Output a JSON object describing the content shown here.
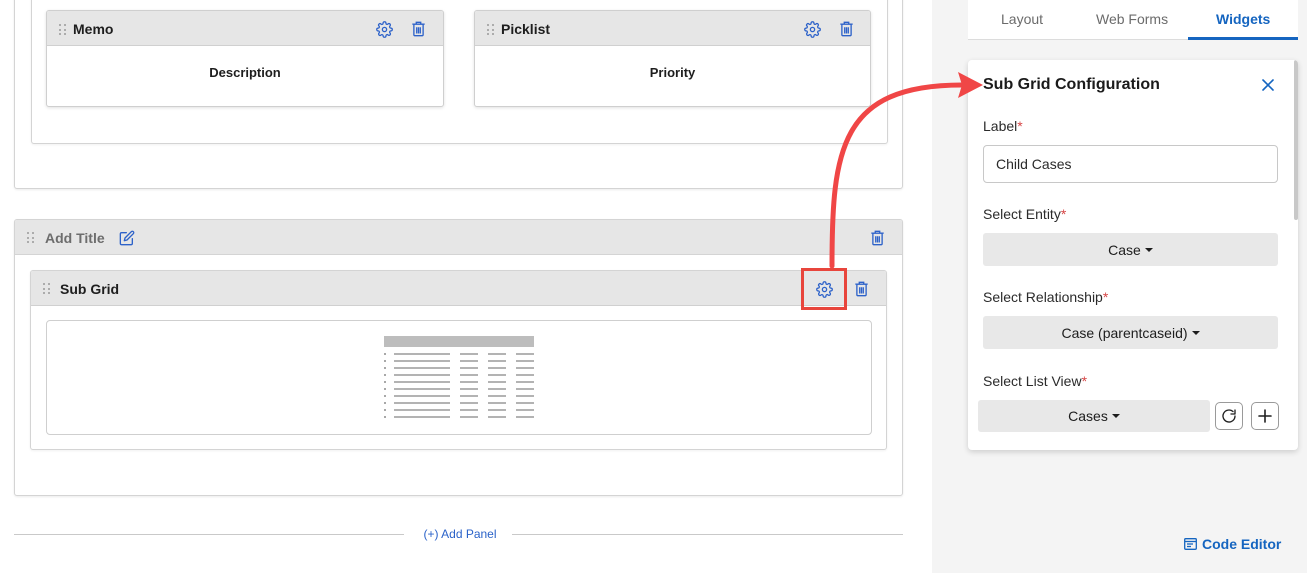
{
  "canvas": {
    "top_section": {
      "fields": [
        {
          "title": "Memo",
          "value": "Description"
        },
        {
          "title": "Picklist",
          "value": "Priority"
        }
      ]
    },
    "panel": {
      "title": "Add Title",
      "subgrid": {
        "title": "Sub Grid"
      }
    },
    "add_panel_label": "(+) Add Panel"
  },
  "tabs": [
    {
      "label": "Layout",
      "active": false
    },
    {
      "label": "Web Forms",
      "active": false
    },
    {
      "label": "Widgets",
      "active": true
    }
  ],
  "config": {
    "title": "Sub Grid Configuration",
    "label_field": {
      "label": "Label",
      "required_mark": "*",
      "value": "Child Cases"
    },
    "entity_field": {
      "label": "Select Entity",
      "required_mark": "*",
      "value": "Case"
    },
    "relationship_field": {
      "label": "Select Relationship",
      "required_mark": "*",
      "value": "Case (parentcaseid)"
    },
    "listview_field": {
      "label": "Select List View",
      "required_mark": "*",
      "value": "Cases"
    }
  },
  "code_editor_label": "Code Editor",
  "colors": {
    "accent": "#1565c0",
    "icon_blue": "#2d62c9",
    "highlight_red": "#e8453c",
    "required_red": "#d64545"
  },
  "icons": {
    "drag": "drag-handle-icon",
    "settings": "gear-icon",
    "delete": "trash-icon",
    "edit": "edit-icon",
    "close": "close-icon",
    "refresh": "refresh-icon",
    "add": "plus-icon",
    "code": "code-editor-icon",
    "grid": "grid-placeholder-icon"
  }
}
